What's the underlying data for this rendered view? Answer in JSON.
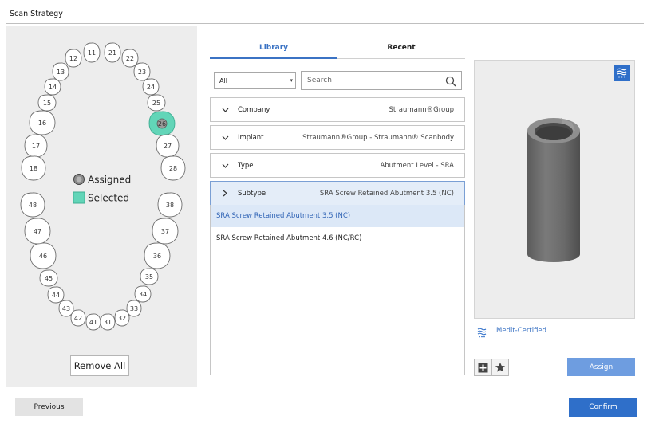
{
  "window": {
    "title": "Scan Strategy"
  },
  "tooth_chart": {
    "teeth": [
      "11",
      "12",
      "13",
      "14",
      "15",
      "16",
      "17",
      "18",
      "21",
      "22",
      "23",
      "24",
      "25",
      "26",
      "27",
      "28",
      "31",
      "32",
      "33",
      "34",
      "35",
      "36",
      "37",
      "38",
      "41",
      "42",
      "43",
      "44",
      "45",
      "46",
      "47",
      "48"
    ],
    "selected_tooth": "26",
    "legend": {
      "assigned": "Assigned",
      "selected": "Selected"
    },
    "colors": {
      "selected": "#62d5b8",
      "assigned": "#8a8a8a"
    },
    "remove_all_label": "Remove All"
  },
  "tabs": [
    {
      "label": "Library",
      "active": true
    },
    {
      "label": "Recent",
      "active": false
    }
  ],
  "filter": {
    "selected": "All"
  },
  "search": {
    "placeholder": "Search",
    "value": ""
  },
  "rows": [
    {
      "label": "Company",
      "value": "Straumann®Group",
      "expanded": false
    },
    {
      "label": "Implant",
      "value": "Straumann®Group - Straumann® Scanbody",
      "expanded": false
    },
    {
      "label": "Type",
      "value": "Abutment Level - SRA",
      "expanded": false
    },
    {
      "label": "Subtype",
      "value": "SRA Screw Retained Abutment 3.5 (NC)",
      "expanded": true
    }
  ],
  "subtype_options": [
    {
      "label": "SRA Screw Retained Abutment 3.5 (NC)",
      "selected": true
    },
    {
      "label": "SRA Screw Retained Abutment 4.6 (NC/RC)",
      "selected": false
    }
  ],
  "preview": {
    "certified_label": "Medit-Certified",
    "badge_icon": "medit-certified-icon"
  },
  "buttons": {
    "assign": "Assign",
    "previous": "Previous",
    "confirm": "Confirm"
  },
  "accent": "#2f6fc9"
}
